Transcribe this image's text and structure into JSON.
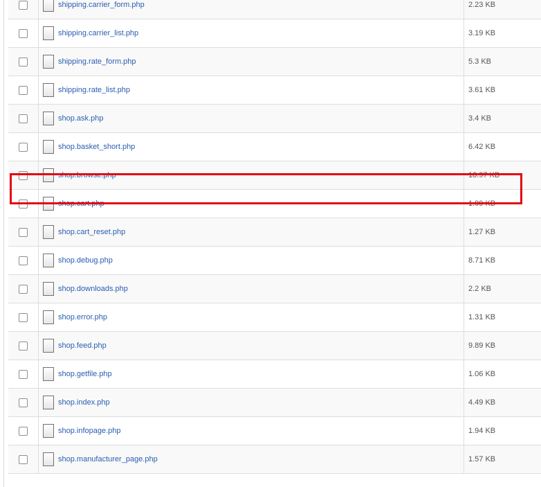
{
  "files": [
    {
      "name": "shipping.carrier_form.php",
      "size": "2.23 KB"
    },
    {
      "name": "shipping.carrier_list.php",
      "size": "3.19 KB"
    },
    {
      "name": "shipping.rate_form.php",
      "size": "5.3 KB"
    },
    {
      "name": "shipping.rate_list.php",
      "size": "3.61 KB"
    },
    {
      "name": "shop.ask.php",
      "size": "3.4 KB"
    },
    {
      "name": "shop.basket_short.php",
      "size": "6.42 KB"
    },
    {
      "name": "shop.browse.php",
      "size": "18.97 KB"
    },
    {
      "name": "shop.cart.php",
      "size": "1.99 KB"
    },
    {
      "name": "shop.cart_reset.php",
      "size": "1.27 KB"
    },
    {
      "name": "shop.debug.php",
      "size": "8.71 KB"
    },
    {
      "name": "shop.downloads.php",
      "size": "2.2 KB"
    },
    {
      "name": "shop.error.php",
      "size": "1.31 KB"
    },
    {
      "name": "shop.feed.php",
      "size": "9.89 KB"
    },
    {
      "name": "shop.getfile.php",
      "size": "1.06 KB"
    },
    {
      "name": "shop.index.php",
      "size": "4.49 KB"
    },
    {
      "name": "shop.infopage.php",
      "size": "1.94 KB"
    },
    {
      "name": "shop.manufacturer_page.php",
      "size": "1.57 KB"
    }
  ],
  "highlighted_file": "shop.browse.php",
  "colors": {
    "link": "#2a5db0",
    "highlight": "#e30613",
    "row_alt": "#f9f9f9",
    "border": "#dddddd"
  },
  "icons": {
    "row_checkbox": "checkbox-unchecked",
    "file": "file-icon"
  }
}
